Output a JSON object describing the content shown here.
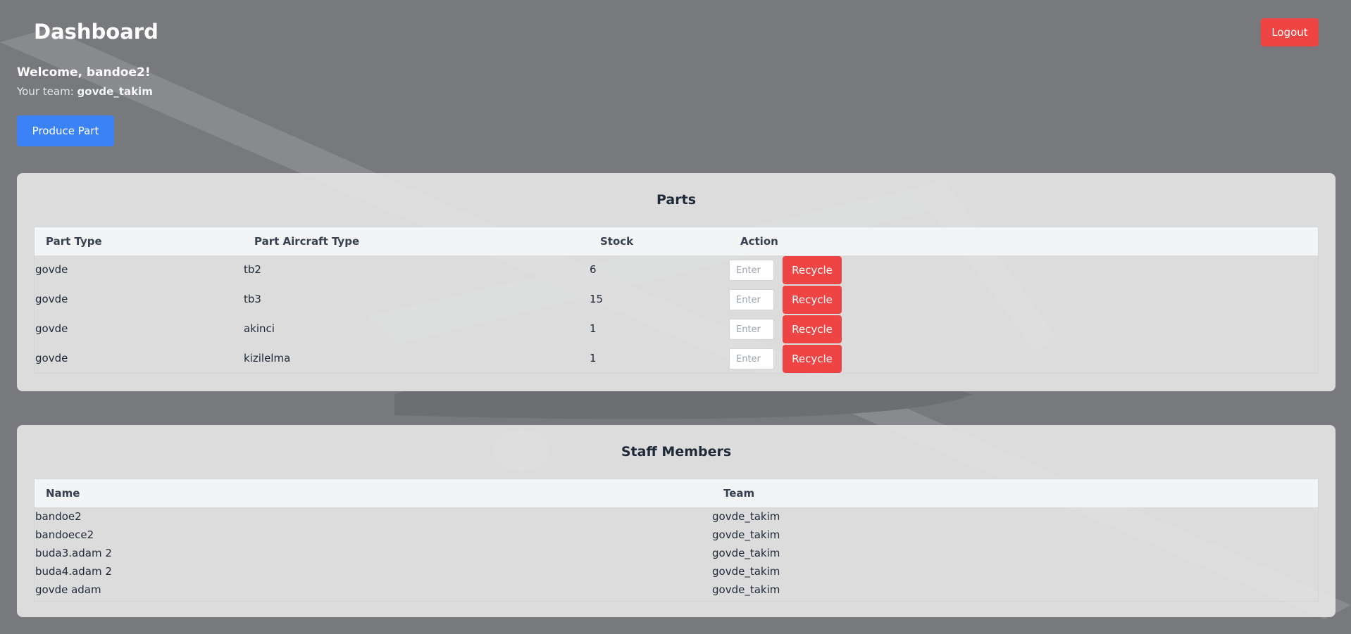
{
  "header": {
    "title": "Dashboard",
    "logout_label": "Logout"
  },
  "user": {
    "welcome": "Welcome, bandoe2!",
    "team_prefix": "Your team:",
    "team_name": "govde_takim"
  },
  "actions": {
    "produce_label": "Produce Part"
  },
  "parts": {
    "title": "Parts",
    "columns": [
      "Part Type",
      "Part Aircraft Type",
      "Stock",
      "Action"
    ],
    "input_placeholder": "Enter",
    "recycle_label": "Recycle",
    "rows": [
      {
        "part_type": "govde",
        "aircraft_type": "tb2",
        "stock": "6"
      },
      {
        "part_type": "govde",
        "aircraft_type": "tb3",
        "stock": "15"
      },
      {
        "part_type": "govde",
        "aircraft_type": "akinci",
        "stock": "1"
      },
      {
        "part_type": "govde",
        "aircraft_type": "kizilelma",
        "stock": "1"
      }
    ]
  },
  "staff": {
    "title": "Staff Members",
    "columns": [
      "Name",
      "Team"
    ],
    "rows": [
      {
        "name": "bandoe2",
        "team": "govde_takim"
      },
      {
        "name": "bandoece2",
        "team": "govde_takim"
      },
      {
        "name": "buda3.adam 2",
        "team": "govde_takim"
      },
      {
        "name": "buda4.adam 2",
        "team": "govde_takim"
      },
      {
        "name": "govde adam",
        "team": "govde_takim"
      }
    ]
  },
  "colors": {
    "primary": "#3b82f6",
    "danger": "#ef4444",
    "background": "#78797c"
  }
}
